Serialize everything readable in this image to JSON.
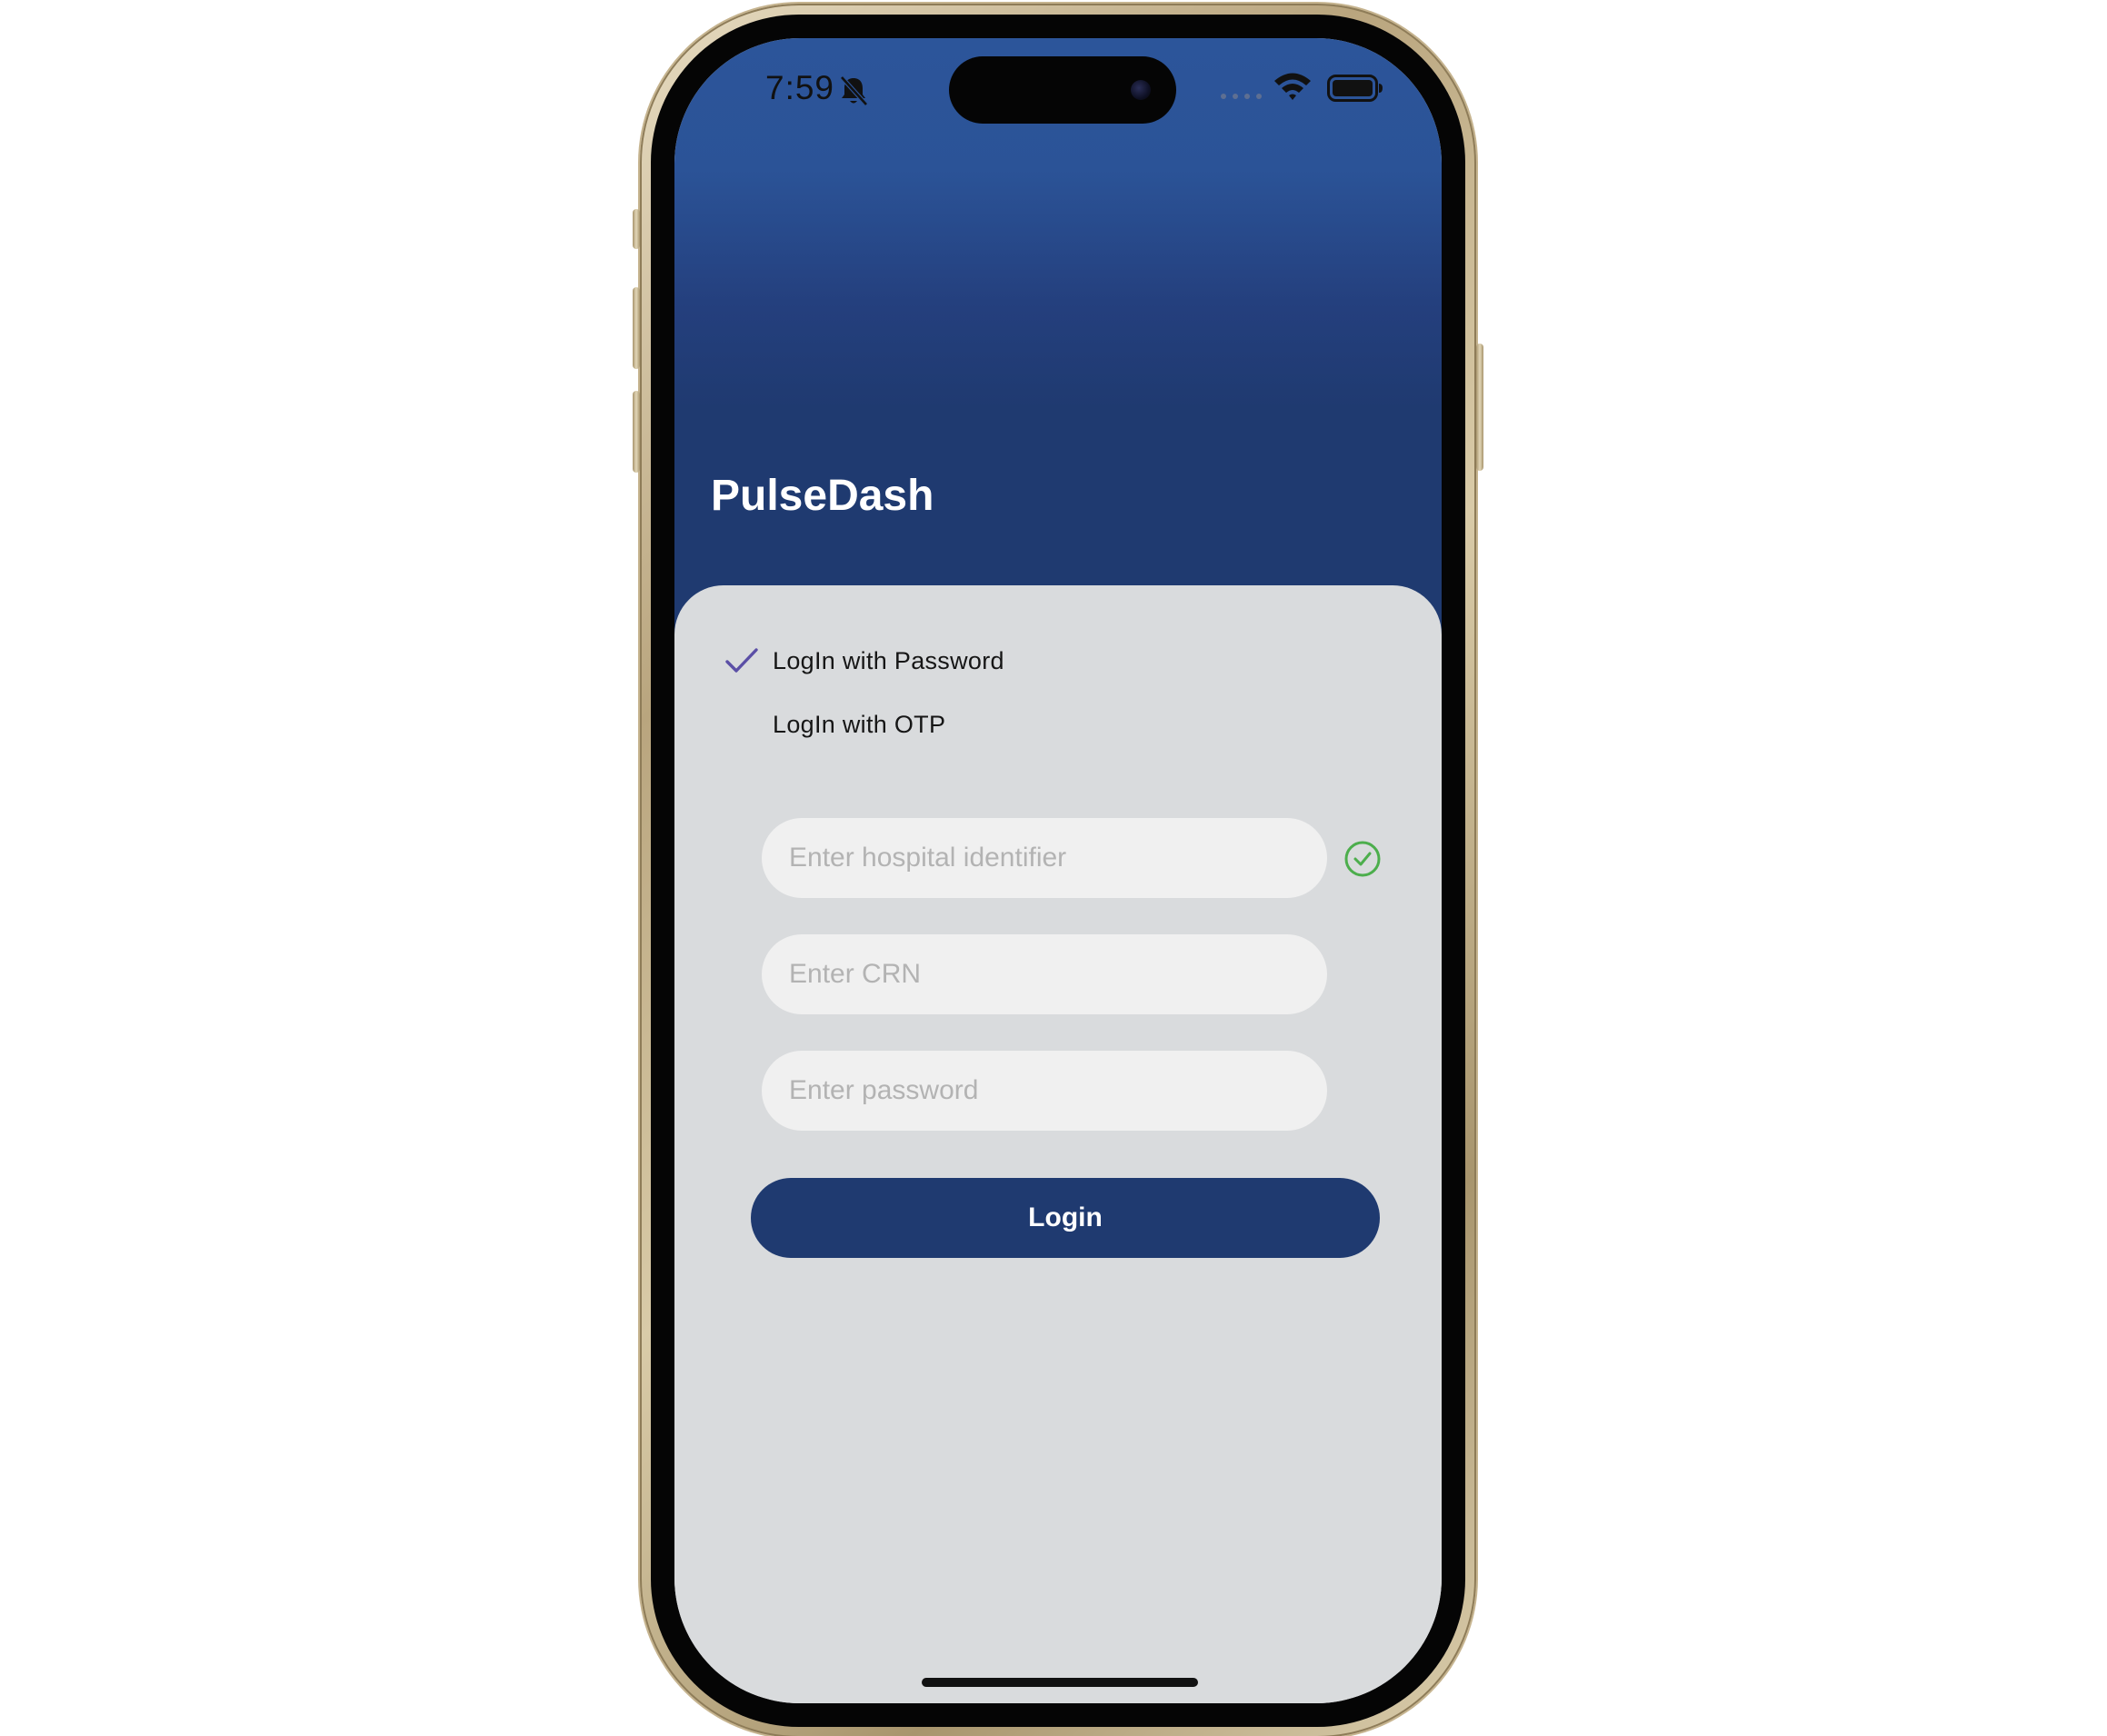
{
  "status_bar": {
    "time": "7:59",
    "icons": [
      "bell-slash-icon",
      "signal-dots-icon",
      "wifi-icon",
      "battery-icon"
    ]
  },
  "app": {
    "title": "PulseDash"
  },
  "login_options": [
    {
      "label": "LogIn with Password",
      "selected": true
    },
    {
      "label": "LogIn with OTP",
      "selected": false
    }
  ],
  "form": {
    "hospital_identifier": {
      "placeholder": "Enter hospital identifier",
      "value": "",
      "verified_icon": "check-circle-icon"
    },
    "crn": {
      "placeholder": "Enter CRN",
      "value": ""
    },
    "password": {
      "placeholder": "Enter password",
      "value": ""
    },
    "submit_label": "Login"
  },
  "colors": {
    "header_top": "#2c559a",
    "header_bottom": "#1f3a70",
    "card_background": "#d9dbdd",
    "field_background": "#f0f0f0",
    "primary_button": "#1f3a70",
    "check_accent": "#5b4fa6",
    "verified_green": "#4cae4c"
  }
}
